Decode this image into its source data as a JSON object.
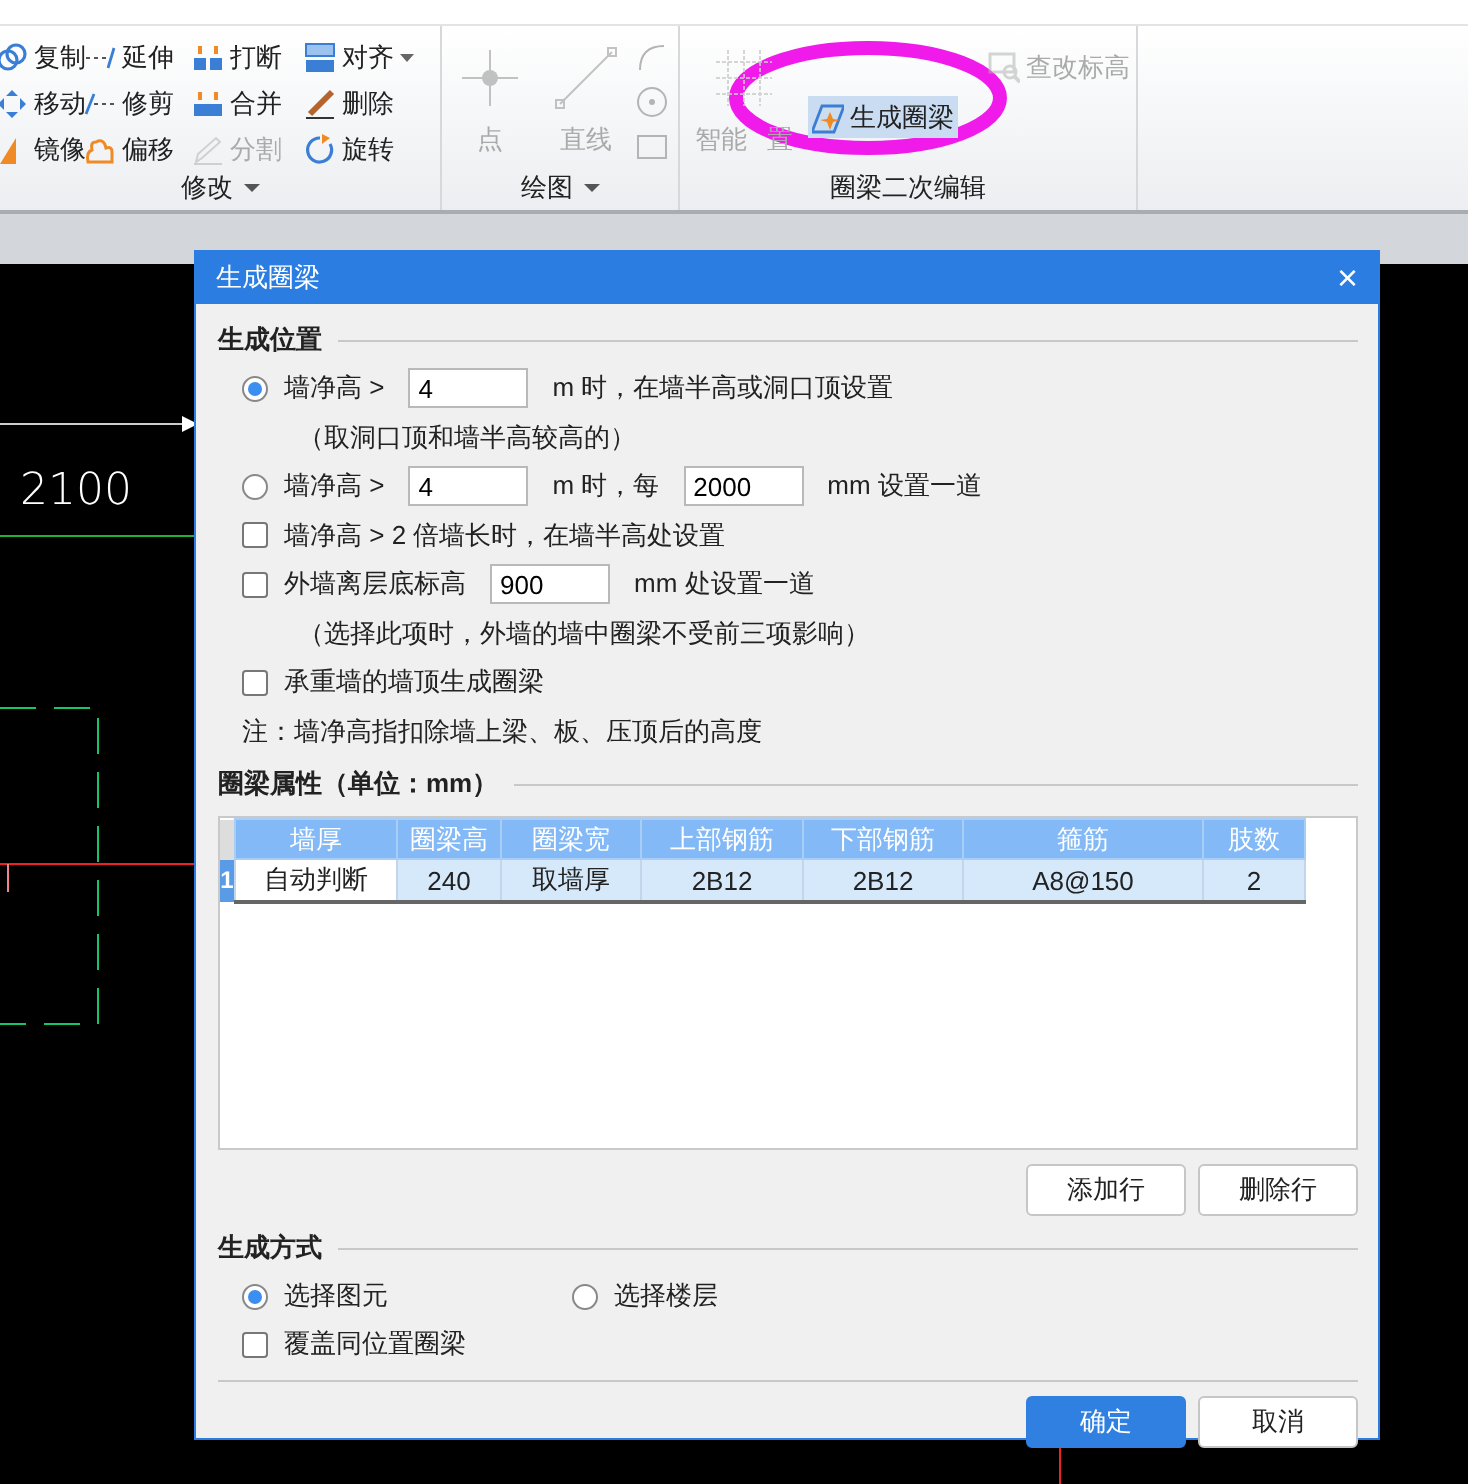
{
  "ribbon": {
    "groups": [
      {
        "label": "修改",
        "items": [
          {
            "label": "复制",
            "disabled": false
          },
          {
            "label": "延伸",
            "disabled": false
          },
          {
            "label": "打断",
            "disabled": false
          },
          {
            "label": "对齐",
            "disabled": false,
            "dropdown": true
          },
          {
            "label": "移动",
            "disabled": false
          },
          {
            "label": "修剪",
            "disabled": false
          },
          {
            "label": "合并",
            "disabled": false
          },
          {
            "label": "删除",
            "disabled": false
          },
          {
            "label": "镜像",
            "disabled": false
          },
          {
            "label": "偏移",
            "disabled": false
          },
          {
            "label": "分割",
            "disabled": true
          },
          {
            "label": "旋转",
            "disabled": false
          }
        ]
      },
      {
        "label": "绘图",
        "items": [
          {
            "label": "点",
            "disabled": true,
            "kind": "large"
          },
          {
            "label": "直线",
            "disabled": true,
            "kind": "large"
          },
          {
            "disabled": true,
            "kind": "small"
          },
          {
            "disabled": true,
            "kind": "small"
          },
          {
            "disabled": true,
            "kind": "small"
          }
        ]
      },
      {
        "label": "圈梁二次编辑",
        "items": [
          {
            "label": "智能",
            "label_tail": "置",
            "disabled": true,
            "kind": "large"
          },
          {
            "label": "查改标高",
            "disabled": true,
            "kind": "small"
          },
          {
            "label": "生成圈梁",
            "disabled": false,
            "selected": true,
            "kind": "small"
          }
        ]
      }
    ]
  },
  "canvas": {
    "dimension": "2100"
  },
  "dialog": {
    "title": "生成圈梁",
    "close": "×",
    "position": {
      "title": "生成位置",
      "rows": [
        {
          "kind": "radio",
          "selected": true,
          "parts": [
            {
              "kind": "text",
              "text": "墙净高 >"
            },
            {
              "kind": "field",
              "value": "4"
            },
            {
              "kind": "text",
              "text": "m 时，在墙半高或洞口顶设置"
            }
          ]
        },
        {
          "kind": "note",
          "text": "（取洞口顶和墙半高较高的）"
        },
        {
          "kind": "radio",
          "selected": false,
          "parts": [
            {
              "kind": "text",
              "text": "墙净高 >"
            },
            {
              "kind": "field",
              "value": "4"
            },
            {
              "kind": "text",
              "text": "m 时，每"
            },
            {
              "kind": "field",
              "value": "2000"
            },
            {
              "kind": "text",
              "text": "mm 设置一道"
            }
          ]
        },
        {
          "kind": "checkbox",
          "checked": false,
          "parts": [
            {
              "kind": "text",
              "text": "墙净高 > 2 倍墙长时，在墙半高处设置"
            }
          ]
        },
        {
          "kind": "checkbox",
          "checked": false,
          "parts": [
            {
              "kind": "text",
              "text": "外墙离层底标高"
            },
            {
              "kind": "field",
              "value": "900"
            },
            {
              "kind": "text",
              "text": "mm 处设置一道"
            }
          ]
        },
        {
          "kind": "note",
          "text": "（选择此项时，外墙的墙中圈梁不受前三项影响）"
        },
        {
          "kind": "checkbox",
          "checked": false,
          "parts": [
            {
              "kind": "text",
              "text": "承重墙的墙顶生成圈梁"
            }
          ]
        },
        {
          "kind": "remark",
          "text": "注：墙净高指扣除墙上梁、板、压顶后的高度"
        }
      ]
    },
    "properties": {
      "title": "圈梁属性（单位：mm）",
      "table": {
        "columns": [
          "墙厚",
          "圈梁高",
          "圈梁宽",
          "上部钢筋",
          "下部钢筋",
          "箍筋",
          "肢数"
        ],
        "rows": [
          {
            "number": "1",
            "selected": true,
            "cells": [
              {
                "text": "自动判断",
                "focused": true
              },
              {
                "text": "240",
                "focused": false
              },
              {
                "text": "取墙厚",
                "focused": false
              },
              {
                "text": "2B12",
                "focused": false
              },
              {
                "text": "2B12",
                "focused": false
              },
              {
                "text": "A8@150",
                "focused": false
              },
              {
                "text": "2",
                "focused": false
              }
            ]
          }
        ]
      },
      "buttons": [
        "添加行",
        "删除行"
      ]
    },
    "method": {
      "title": "生成方式",
      "options": [
        {
          "label": "选择图元",
          "selected": true
        },
        {
          "label": "选择楼层",
          "selected": false
        }
      ],
      "checkbox": {
        "label": "覆盖同位置圈梁",
        "checked": false
      }
    },
    "buttons": [
      {
        "label": "确定",
        "primary": true
      },
      {
        "label": "取消",
        "primary": false
      }
    ]
  }
}
